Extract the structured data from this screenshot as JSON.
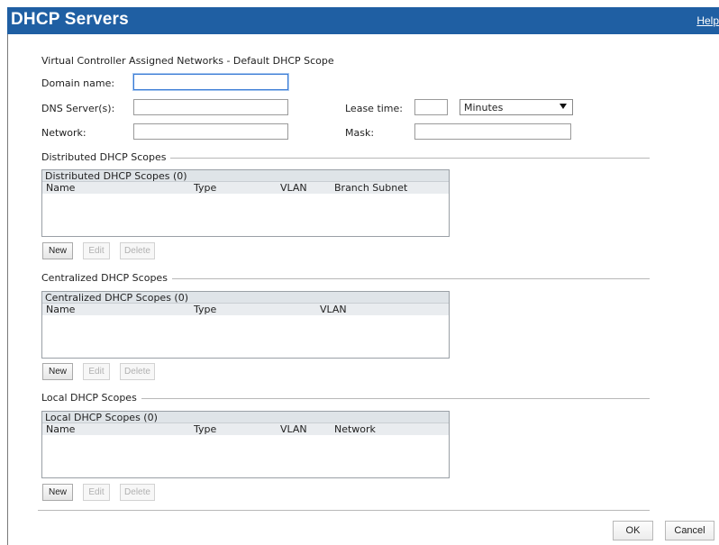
{
  "window": {
    "title": "DHCP Servers",
    "help_link": "Help"
  },
  "default_scope": {
    "heading": "Virtual Controller Assigned Networks - Default DHCP Scope",
    "domain_name": {
      "label": "Domain name:",
      "value": ""
    },
    "dns_servers": {
      "label": "DNS Server(s):",
      "value": ""
    },
    "network": {
      "label": "Network:",
      "value": ""
    },
    "lease_time": {
      "label": "Lease time:",
      "value": "",
      "unit": "Minutes"
    },
    "mask": {
      "label": "Mask:",
      "value": ""
    }
  },
  "distributed": {
    "section_title": "Distributed DHCP Scopes",
    "table_title": "Distributed DHCP Scopes (0)",
    "columns": [
      "Name",
      "Type",
      "VLAN",
      "Branch Subnet"
    ],
    "rows": []
  },
  "centralized": {
    "section_title": "Centralized DHCP Scopes",
    "table_title": "Centralized DHCP Scopes (0)",
    "columns": [
      "Name",
      "Type",
      "VLAN"
    ],
    "rows": []
  },
  "local": {
    "section_title": "Local DHCP Scopes",
    "table_title": "Local DHCP Scopes (0)",
    "columns": [
      "Name",
      "Type",
      "VLAN",
      "Network"
    ],
    "rows": []
  },
  "actions": {
    "new": "New",
    "edit": "Edit",
    "delete": "Delete"
  },
  "footer": {
    "ok": "OK",
    "cancel": "Cancel"
  },
  "colors": {
    "titlebar": "#1f5fa3",
    "grid_header": "#dfe4e8"
  }
}
